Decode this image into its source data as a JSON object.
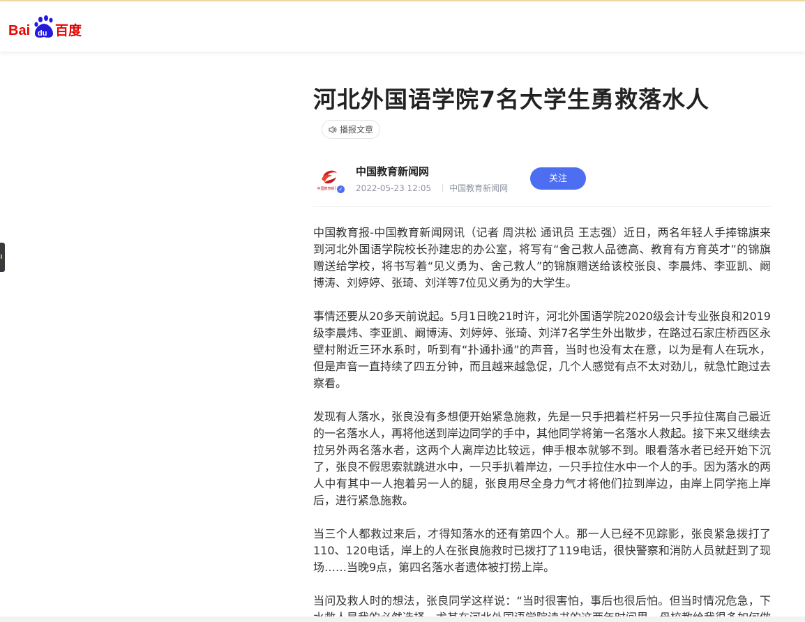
{
  "header": {
    "logo_text": "Baidu百度",
    "logo_colors": {
      "red": "#e10602",
      "blue": "#2319dc"
    }
  },
  "article": {
    "title": "河北外国语学院7名大学生勇救落水人",
    "listen_label": "播报文章",
    "author": {
      "name": "中国教育新闻网",
      "date": "2022-05-23 12:05",
      "source": "中国教育新闻网",
      "follow_label": "关注",
      "avatar_text": "中国教育新闻网"
    },
    "paragraphs": [
      "中国教育报-中国教育新闻网讯（记者 周洪松 通讯员 王志强）近日，两名年轻人手捧锦旗来到河北外国语学院校长孙建忠的办公室，将写有“舍己救人品德高、教育有方育英才”的锦旗赠送给学校，将书写着“见义勇为、舍己救人”的锦旗赠送给该校张良、李晨炜、李亚凯、阚博涛、刘婷婷、张琦、刘洋等7位见义勇为的大学生。",
      "事情还要从20多天前说起。5月1日晚21时许，河北外国语学院2020级会计专业张良和2019级李晨炜、李亚凯、阚博涛、刘婷婷、张琦、刘洋7名学生外出散步，在路过石家庄桥西区永壁村附近三环水系时，听到有“扑通扑通”的声音，当时也没有太在意，以为是有人在玩水，但是声音一直持续了四五分钟，而且越来越急促，几个人感觉有点不太对劲儿，就急忙跑过去察看。",
      "发现有人落水，张良没有多想便开始紧急施救，先是一只手把着栏杆另一只手拉住离自己最近的一名落水人，再将他送到岸边同学的手中，其他同学将第一名落水人救起。接下来又继续去拉另外两名落水者，这两个人离岸边比较远，伸手根本就够不到。眼看落水者已经开始下沉了，张良不假思索就跳进水中，一只手扒着岸边，一只手拉住水中一个人的手。因为落水的两人中有其中一人抱着另一人的腿，张良用尽全身力气才将他们拉到岸边，由岸上同学拖上岸后，进行紧急施救。",
      "当三个人都救过来后，才得知落水的还有第四个人。那一人已经不见踪影，张良紧急拨打了110、120电话，岸上的人在张良施救时已拨打了119电话，很快警察和消防人员就赶到了现场……当晚9点，第四名落水者遗体被打捞上岸。",
      "当问及救人时的想法，张良同学这样说：“当时很害怕，事后也很后怕。但当时情况危急，下水救人是我的必然选择，尤其在河北外国语学院读书的这两年时间里，母校教给我很多如何做"
    ]
  },
  "colors": {
    "accent": "#4e6ef2",
    "title": "#222222",
    "body": "#333333",
    "meta": "#9195a3"
  },
  "icons": {
    "listen": "speaker-icon",
    "verified": "verified-badge-icon"
  }
}
